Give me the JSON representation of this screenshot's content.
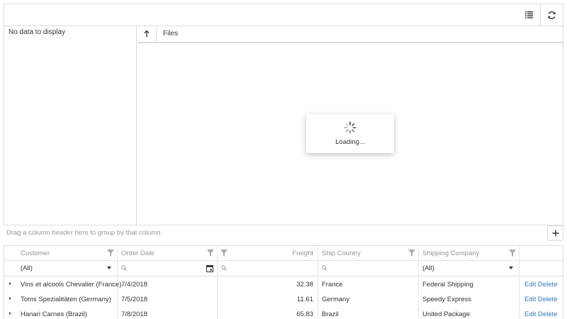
{
  "file_manager": {
    "no_data_text": "No data to display",
    "files_column": "Files",
    "loading_text": "Loading...",
    "toolbar_icons": [
      "details-view-icon",
      "refresh-icon"
    ]
  },
  "grid": {
    "group_panel_text": "Drag a column header here to group by that column",
    "columns": [
      "Customer",
      "Order Date",
      "Freight",
      "Ship Country",
      "Shipping Company"
    ],
    "filters": {
      "customer": "(All)",
      "shipping_company": "(All)"
    },
    "rows": [
      {
        "customer": "Vins et alcools Chevalier (France)",
        "order_date": "7/4/2018",
        "freight": "32.38",
        "ship_country": "France",
        "shipping_company": "Federal Shipping"
      },
      {
        "customer": "Toms Spezialitäten (Germany)",
        "order_date": "7/5/2018",
        "freight": "11.61",
        "ship_country": "Germany",
        "shipping_company": "Speedy Express"
      },
      {
        "customer": "Hanari Carnes (Brazil)",
        "order_date": "7/8/2018",
        "freight": "65.83",
        "ship_country": "Brazil",
        "shipping_company": "United Package"
      }
    ],
    "actions": {
      "edit": "Edit",
      "delete": "Delete"
    }
  }
}
